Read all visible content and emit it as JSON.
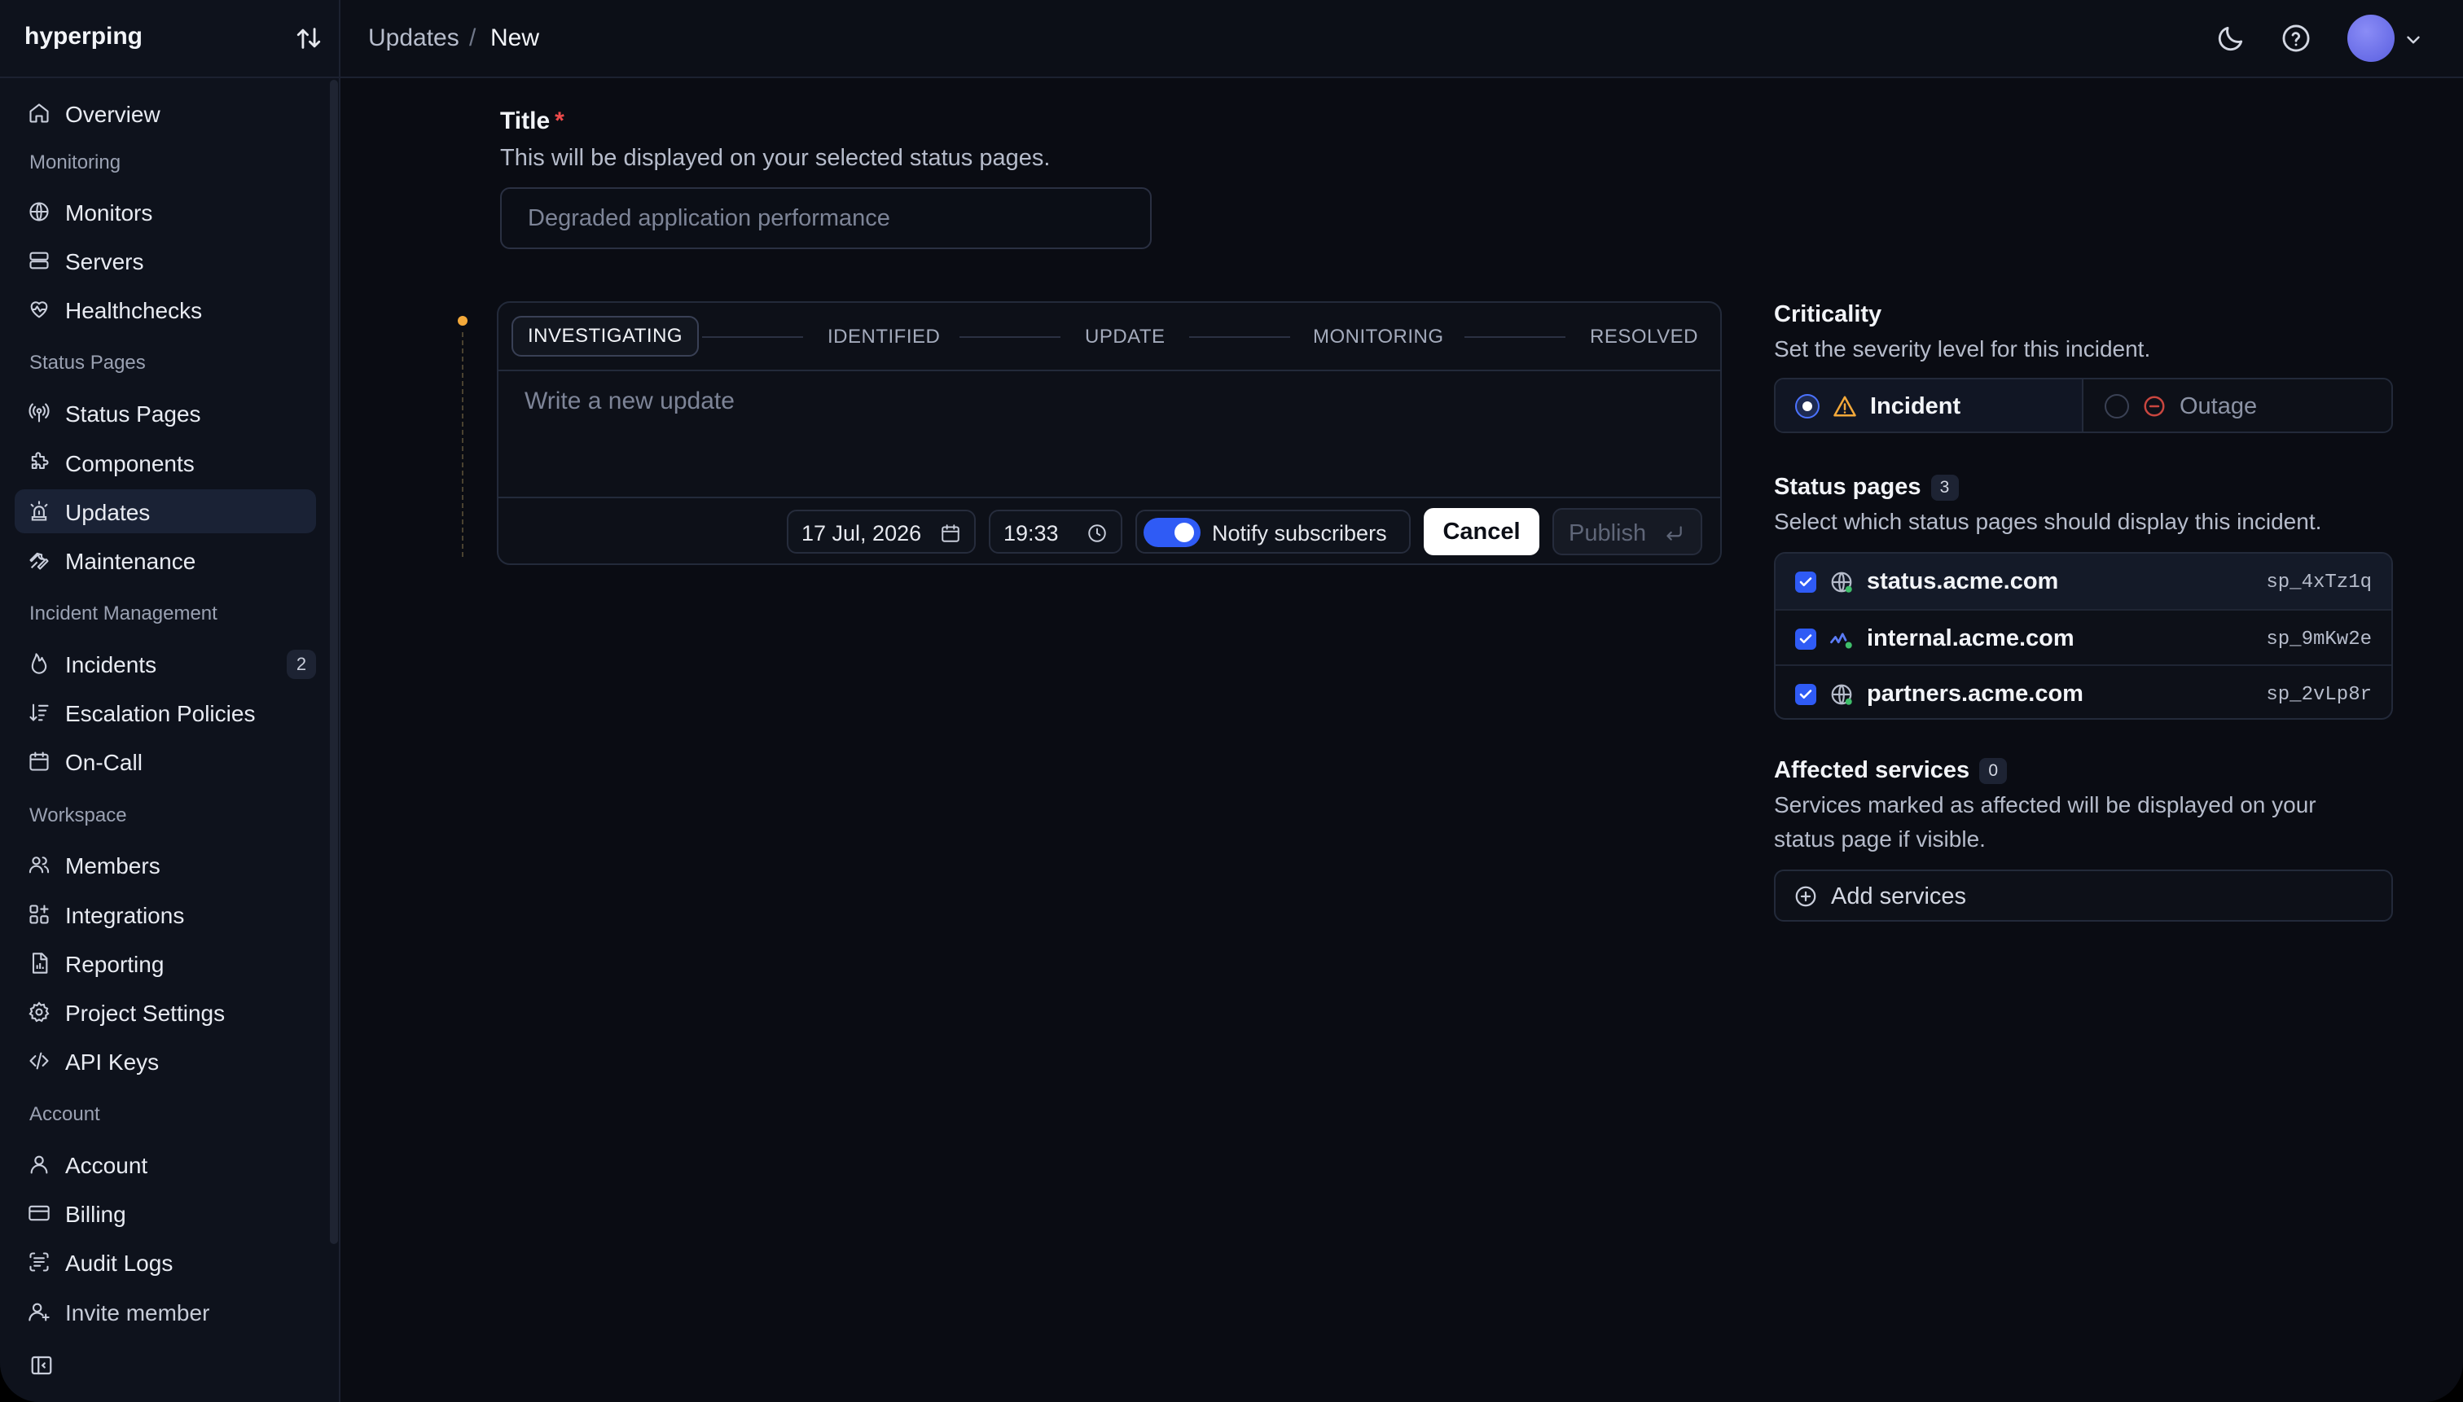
{
  "app": {
    "name": "hyperping"
  },
  "sidebar": {
    "top": [
      {
        "label": "Overview",
        "icon": "home-icon"
      }
    ],
    "sections": [
      {
        "label": "Monitoring",
        "items": [
          {
            "label": "Monitors",
            "icon": "globe-icon"
          },
          {
            "label": "Servers",
            "icon": "server-icon"
          },
          {
            "label": "Healthchecks",
            "icon": "heart-pulse-icon"
          }
        ]
      },
      {
        "label": "Status Pages",
        "items": [
          {
            "label": "Status Pages",
            "icon": "broadcast-icon"
          },
          {
            "label": "Components",
            "icon": "puzzle-icon"
          },
          {
            "label": "Updates",
            "icon": "siren-icon",
            "active": true
          },
          {
            "label": "Maintenance",
            "icon": "wrench-icon"
          }
        ]
      },
      {
        "label": "Incident Management",
        "items": [
          {
            "label": "Incidents",
            "icon": "flame-icon",
            "count": "2"
          },
          {
            "label": "Escalation Policies",
            "icon": "sort-icon"
          },
          {
            "label": "On-Call",
            "icon": "calendar-icon"
          }
        ]
      },
      {
        "label": "Workspace",
        "items": [
          {
            "label": "Members",
            "icon": "users-icon"
          },
          {
            "label": "Integrations",
            "icon": "grid-plus-icon"
          },
          {
            "label": "Reporting",
            "icon": "file-chart-icon"
          },
          {
            "label": "Project Settings",
            "icon": "gear-icon"
          },
          {
            "label": "API Keys",
            "icon": "code-icon"
          }
        ]
      },
      {
        "label": "Account",
        "items": [
          {
            "label": "Account",
            "icon": "user-icon"
          },
          {
            "label": "Billing",
            "icon": "credit-card-icon"
          },
          {
            "label": "Audit Logs",
            "icon": "scan-text-icon"
          }
        ]
      }
    ],
    "invite": {
      "label": "Invite member",
      "icon": "user-plus-icon"
    }
  },
  "header": {
    "breadcrumb": [
      "Updates",
      "New"
    ],
    "separator": "/"
  },
  "form": {
    "title_label": "Title",
    "title_required": "*",
    "title_help": "This will be displayed on your selected status pages.",
    "title_value": "",
    "title_placeholder": "Degraded application performance",
    "stages": [
      "INVESTIGATING",
      "IDENTIFIED",
      "UPDATE",
      "MONITORING",
      "RESOLVED"
    ],
    "active_stage": "INVESTIGATING",
    "update_value": "",
    "update_placeholder": "Write a new update",
    "date": "17 Jul, 2026",
    "time": "19:33",
    "notify_label": "Notify subscribers",
    "notify_on": true,
    "cancel_label": "Cancel",
    "publish_label": "Publish"
  },
  "criticality": {
    "heading": "Criticality",
    "help": "Set the severity level for this incident.",
    "options": [
      {
        "label": "Incident",
        "selected": true,
        "icon": "warning-triangle-icon",
        "color": "#f4a93a"
      },
      {
        "label": "Outage",
        "selected": false,
        "icon": "minus-circle-icon",
        "color": "#d9534f"
      }
    ]
  },
  "status_pages": {
    "heading": "Status pages",
    "count": "3",
    "help": "Select which status pages should display this incident.",
    "items": [
      {
        "name": "status.acme.com",
        "id": "sp_4xTz1q",
        "checked": true,
        "icon": "globe-icon"
      },
      {
        "name": "internal.acme.com",
        "id": "sp_9mKw2e",
        "checked": true,
        "icon": "activity-icon"
      },
      {
        "name": "partners.acme.com",
        "id": "sp_2vLp8r",
        "checked": true,
        "icon": "globe-icon"
      }
    ]
  },
  "affected_services": {
    "heading": "Affected services",
    "count": "0",
    "help_line1": "Services marked as affected will be displayed on your",
    "help_line2": "status page if visible.",
    "add_label": "Add services"
  },
  "colors": {
    "accent": "#2f5bf5",
    "background": "#0a0c13",
    "sidebar": "#0e121c",
    "timeline_dot": "#f4a93a",
    "required": "#ef4b4b"
  }
}
